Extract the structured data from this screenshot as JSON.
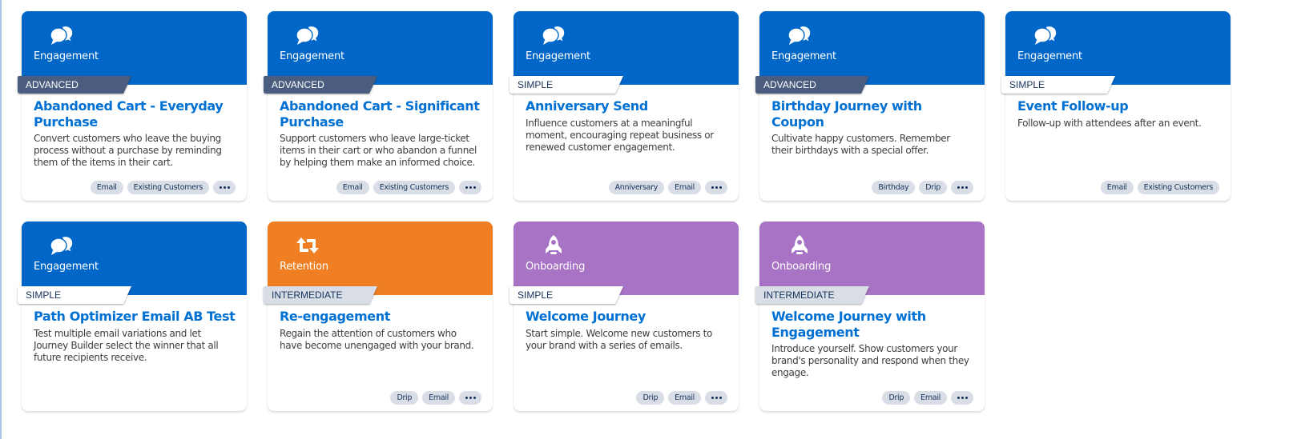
{
  "colors": {
    "engagement": "#0067c9",
    "retention": "#ef7f22",
    "onboarding": "#a873c5",
    "title": "#0070d2",
    "advanced_badge": "#4a5d7e",
    "intermediate_badge": "#d8dde6",
    "simple_badge": "#ffffff",
    "tag_bg": "#d8dde6"
  },
  "more_label": "More tags",
  "templates": [
    {
      "category": "Engagement",
      "category_key": "engagement",
      "icon": "chat-bubbles-icon",
      "level": "ADVANCED",
      "level_key": "advanced",
      "title": "Abandoned Cart - Everyday Purchase",
      "description": "Convert customers who leave the buying process without a purchase by reminding them of the items in their cart.",
      "tags": [
        "Email",
        "Existing Customers"
      ],
      "has_more": true
    },
    {
      "category": "Engagement",
      "category_key": "engagement",
      "icon": "chat-bubbles-icon",
      "level": "ADVANCED",
      "level_key": "advanced",
      "title": "Abandoned Cart - Significant Purchase",
      "description": "Support customers who leave large-ticket items in their cart or who abandon a funnel by helping them make an informed choice.",
      "tags": [
        "Email",
        "Existing Customers"
      ],
      "has_more": true
    },
    {
      "category": "Engagement",
      "category_key": "engagement",
      "icon": "chat-bubbles-icon",
      "level": "SIMPLE",
      "level_key": "simple",
      "title": "Anniversary Send",
      "description": "Influence customers at a meaningful moment, encouraging repeat business or renewed customer engagement.",
      "tags": [
        "Anniversary",
        "Email"
      ],
      "has_more": true
    },
    {
      "category": "Engagement",
      "category_key": "engagement",
      "icon": "chat-bubbles-icon",
      "level": "ADVANCED",
      "level_key": "advanced",
      "title": "Birthday Journey with Coupon",
      "description": "Cultivate happy customers. Remember their birthdays with a special offer.",
      "tags": [
        "Birthday",
        "Drip"
      ],
      "has_more": true
    },
    {
      "category": "Engagement",
      "category_key": "engagement",
      "icon": "chat-bubbles-icon",
      "level": "SIMPLE",
      "level_key": "simple",
      "title": "Event Follow-up",
      "description": "Follow-up with attendees after an event.",
      "tags": [
        "Email",
        "Existing Customers"
      ],
      "has_more": false
    },
    {
      "category": "Engagement",
      "category_key": "engagement",
      "icon": "chat-bubbles-icon",
      "level": "SIMPLE",
      "level_key": "simple",
      "title": "Path Optimizer Email AB Test",
      "description": "Test multiple email variations and let Journey Builder select the winner that all future recipients receive.",
      "tags": [],
      "has_more": false
    },
    {
      "category": "Retention",
      "category_key": "retention",
      "icon": "retweet-arrows-icon",
      "level": "INTERMEDIATE",
      "level_key": "intermediate",
      "title": "Re-engagement",
      "description": "Regain the attention of customers who have become unengaged with your brand.",
      "tags": [
        "Drip",
        "Email"
      ],
      "has_more": true
    },
    {
      "category": "Onboarding",
      "category_key": "onboarding",
      "icon": "rocket-icon",
      "level": "SIMPLE",
      "level_key": "simple",
      "title": "Welcome Journey",
      "description": "Start simple. Welcome new customers to your brand with a series of emails.",
      "tags": [
        "Drip",
        "Email"
      ],
      "has_more": true
    },
    {
      "category": "Onboarding",
      "category_key": "onboarding",
      "icon": "rocket-icon",
      "level": "INTERMEDIATE",
      "level_key": "intermediate",
      "title": "Welcome Journey with Engagement",
      "description": "Introduce yourself. Show customers your brand's personality and respond when they engage.",
      "tags": [
        "Drip",
        "Email"
      ],
      "has_more": true
    }
  ]
}
